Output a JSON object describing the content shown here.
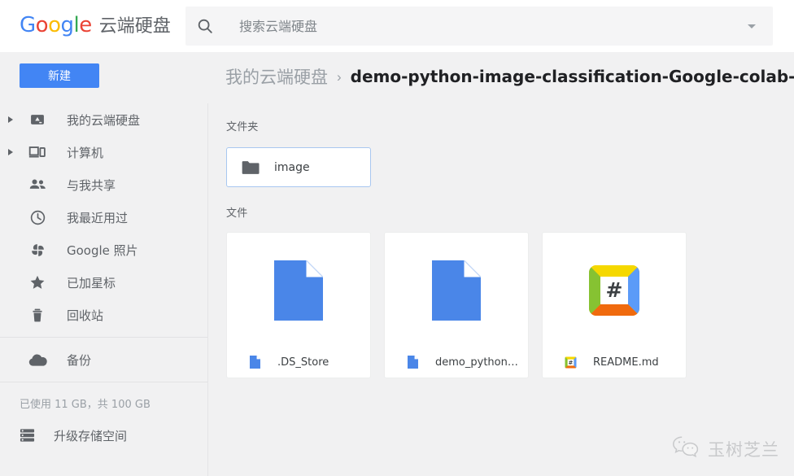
{
  "header": {
    "logo_word": "Google",
    "logo_letters": [
      "G",
      "o",
      "o",
      "g",
      "l",
      "e"
    ],
    "product_name": "云端硬盘",
    "search": {
      "placeholder": "搜索云端硬盘",
      "value": "",
      "icon": "search-icon",
      "options_icon": "chevron-down-icon"
    }
  },
  "toolbar": {
    "new_button_label": "新建"
  },
  "breadcrumb": {
    "root": "我的云端硬盘",
    "separator": "›",
    "current": "demo-python-image-classification-Google-colab-master",
    "caret_icon": "chevron-down-icon"
  },
  "sidebar": {
    "items": [
      {
        "label": "我的云端硬盘",
        "icon": "drive-icon",
        "expandable": true
      },
      {
        "label": "计算机",
        "icon": "computer-icon",
        "expandable": true
      },
      {
        "label": "与我共享",
        "icon": "people-icon",
        "expandable": false
      },
      {
        "label": "我最近用过",
        "icon": "clock-icon",
        "expandable": false
      },
      {
        "label": "Google 照片",
        "icon": "photos-pinwheel-icon",
        "expandable": false
      },
      {
        "label": "已加星标",
        "icon": "star-icon",
        "expandable": false
      },
      {
        "label": "回收站",
        "icon": "trash-icon",
        "expandable": false
      }
    ],
    "backup": {
      "label": "备份",
      "icon": "cloud-icon"
    },
    "storage_text": "已使用 11 GB，共 100 GB",
    "upgrade": {
      "label": "升级存储空间",
      "icon": "storage-stack-icon"
    }
  },
  "main": {
    "folders_label": "文件夹",
    "folders": [
      {
        "name": "image",
        "icon": "folder-icon",
        "selected": true
      }
    ],
    "files_label": "文件",
    "files": [
      {
        "name": ".DS_Store",
        "thumb_icon": "blue-document-icon",
        "foot_icon": "blue-document-icon"
      },
      {
        "name": "demo_python_i...",
        "thumb_icon": "blue-document-icon",
        "foot_icon": "blue-document-icon"
      },
      {
        "name": "README.md",
        "thumb_icon": "markdown-icon",
        "foot_icon": "markdown-icon",
        "glyph": "#"
      }
    ]
  },
  "watermark": {
    "icon": "wechat-icon",
    "text": "玉树芝兰"
  },
  "colors": {
    "accent_blue": "#4285f4",
    "logo_red": "#ea4335",
    "logo_yellow": "#fbbc05",
    "logo_green": "#34a853",
    "page_bg": "#f1f1f2",
    "card_bg": "#ffffff",
    "text_primary": "#3c4043",
    "text_secondary": "#5f6368",
    "text_muted": "#9aa0a6",
    "selected_border": "#a8c7f0"
  }
}
